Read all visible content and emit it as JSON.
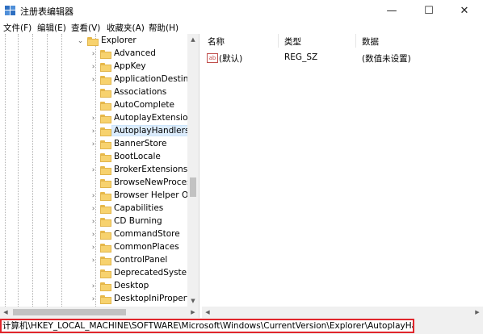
{
  "window": {
    "title": "注册表编辑器",
    "minimize_glyph": "—",
    "maximize_glyph": "☐",
    "close_glyph": "✕",
    "icon": "regedit-icon"
  },
  "menu": [
    "文件(F)",
    "编辑(E)",
    "查看(V)",
    "收藏夹(A)",
    "帮助(H)"
  ],
  "tree": {
    "parent": "Explorer",
    "children": [
      {
        "label": "Advanced",
        "expandable": true
      },
      {
        "label": "AppKey",
        "expandable": true
      },
      {
        "label": "ApplicationDestinati",
        "expandable": true
      },
      {
        "label": "Associations",
        "expandable": false
      },
      {
        "label": "AutoComplete",
        "expandable": false
      },
      {
        "label": "AutoplayExtensions",
        "expandable": true
      },
      {
        "label": "AutoplayHandlers",
        "expandable": true,
        "selected": true
      },
      {
        "label": "BannerStore",
        "expandable": true
      },
      {
        "label": "BootLocale",
        "expandable": false
      },
      {
        "label": "BrokerExtensions",
        "expandable": true
      },
      {
        "label": "BrowseNewProcess",
        "expandable": false
      },
      {
        "label": "Browser Helper Obj",
        "expandable": true
      },
      {
        "label": "Capabilities",
        "expandable": true
      },
      {
        "label": "CD Burning",
        "expandable": true
      },
      {
        "label": "CommandStore",
        "expandable": true
      },
      {
        "label": "CommonPlaces",
        "expandable": true
      },
      {
        "label": "ControlPanel",
        "expandable": true
      },
      {
        "label": "DeprecatedSystemF",
        "expandable": false
      },
      {
        "label": "Desktop",
        "expandable": true
      },
      {
        "label": "DesktopIniProperty",
        "expandable": true
      },
      {
        "label": "",
        "expandable": true
      }
    ]
  },
  "list": {
    "columns": [
      "名称",
      "类型",
      "数据"
    ],
    "rows": [
      {
        "name": "(默认)",
        "type": "REG_SZ",
        "data": "(数值未设置)",
        "icon_text": "ab"
      }
    ]
  },
  "status": {
    "path": "计算机\\HKEY_LOCAL_MACHINE\\SOFTWARE\\Microsoft\\Windows\\CurrentVersion\\Explorer\\AutoplayHandlers",
    "highlight_color": "#e0262c"
  },
  "colors": {
    "selection": "#dcecfc",
    "folder": "#f7d26e"
  }
}
